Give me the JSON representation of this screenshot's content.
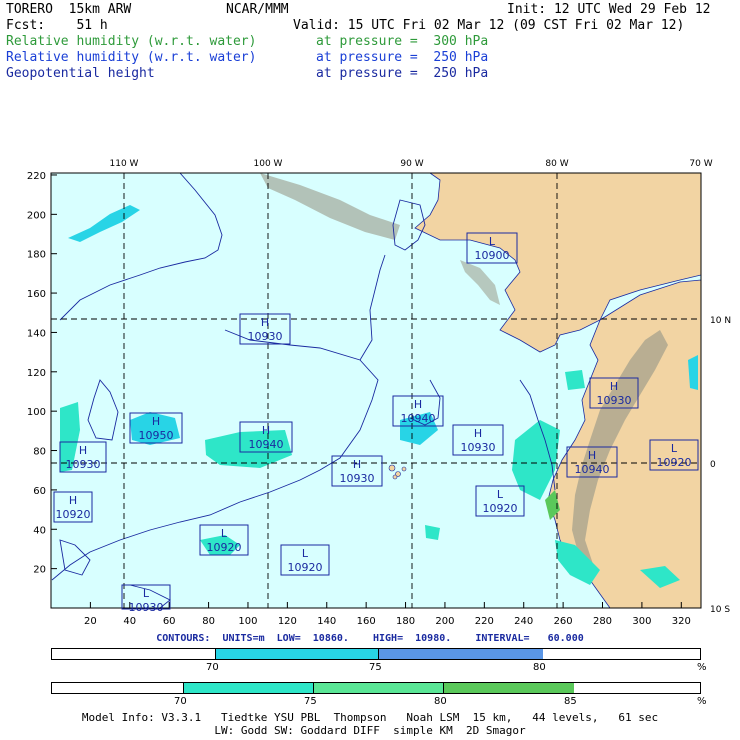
{
  "header": {
    "model": "TORERO  15km ARW",
    "center": "NCAR/MMM",
    "init": "Init: 12 UTC Wed 29 Feb 12",
    "fcst": "Fcst:    51 h",
    "valid": "Valid: 15 UTC Fri 02 Mar 12 (09 CST Fri 02 Mar 12)",
    "fields": [
      {
        "name": "Relative humidity (w.r.t. water)",
        "level": "at pressure =  300 hPa",
        "color": "#2e9a3a"
      },
      {
        "name": "Relative humidity (w.r.t. water)",
        "level": "at pressure =  250 hPa",
        "color": "#1a3fd6"
      },
      {
        "name": "Geopotential height",
        "level": "at pressure =  250 hPa",
        "color": "#1a2aa0"
      }
    ]
  },
  "map": {
    "top_lon_labels": [
      "110 W",
      "100 W",
      "90 W",
      "80 W",
      "70 W"
    ],
    "right_lat_labels": [
      "10 N",
      "0",
      "10 S"
    ],
    "x_ticks": [
      "20",
      "40",
      "60",
      "80",
      "100",
      "120",
      "140",
      "160",
      "180",
      "200",
      "220",
      "240",
      "260",
      "280",
      "300",
      "320"
    ],
    "y_ticks": [
      "20",
      "40",
      "60",
      "80",
      "100",
      "120",
      "140",
      "160",
      "180",
      "200",
      "220"
    ],
    "colors": {
      "ocean": "#d8ffff",
      "land": "#f2d4a3",
      "mountain": "#8a8a78",
      "boundary": "#1a2aa0",
      "grid": "#000000"
    },
    "pressure_labels": [
      {
        "type": "L",
        "value": "10900"
      },
      {
        "type": "H",
        "value": "10930"
      },
      {
        "type": "H",
        "value": "10950"
      },
      {
        "type": "H",
        "value": "10940"
      },
      {
        "type": "H",
        "value": "10940"
      },
      {
        "type": "H",
        "value": "10930"
      },
      {
        "type": "H",
        "value": "10930"
      },
      {
        "type": "H",
        "value": "10930"
      },
      {
        "type": "H",
        "value": "10930"
      },
      {
        "type": "H",
        "value": "10940"
      },
      {
        "type": "L",
        "value": "10920"
      },
      {
        "type": "H",
        "value": "10920"
      },
      {
        "type": "L",
        "value": "10920"
      },
      {
        "type": "L",
        "value": "10920"
      },
      {
        "type": "L",
        "value": "10920"
      },
      {
        "type": "L",
        "value": "10930"
      }
    ]
  },
  "contours": {
    "units_label": "CONTOURS:  UNITS=m",
    "low": "LOW=  10860.",
    "high": "HIGH=  10980.",
    "interval": "INTERVAL=   60.000"
  },
  "legend_250": {
    "ticks": [
      "70",
      "75",
      "80"
    ],
    "unit": "%",
    "colors": [
      "#ffffff",
      "#28d4e6",
      "#5a96e6"
    ]
  },
  "legend_300": {
    "ticks": [
      "70",
      "75",
      "80",
      "85"
    ],
    "unit": "%",
    "colors": [
      "#ffffff",
      "#2ee6c8",
      "#5ae696",
      "#5ac85a"
    ]
  },
  "footer": {
    "line1": "Model Info: V3.3.1   Tiedtke YSU PBL  Thompson   Noah LSM  15 km,   44 levels,   61 sec",
    "line2": "LW: Godd SW: Goddard DIFF  simple KM  2D Smagor"
  }
}
